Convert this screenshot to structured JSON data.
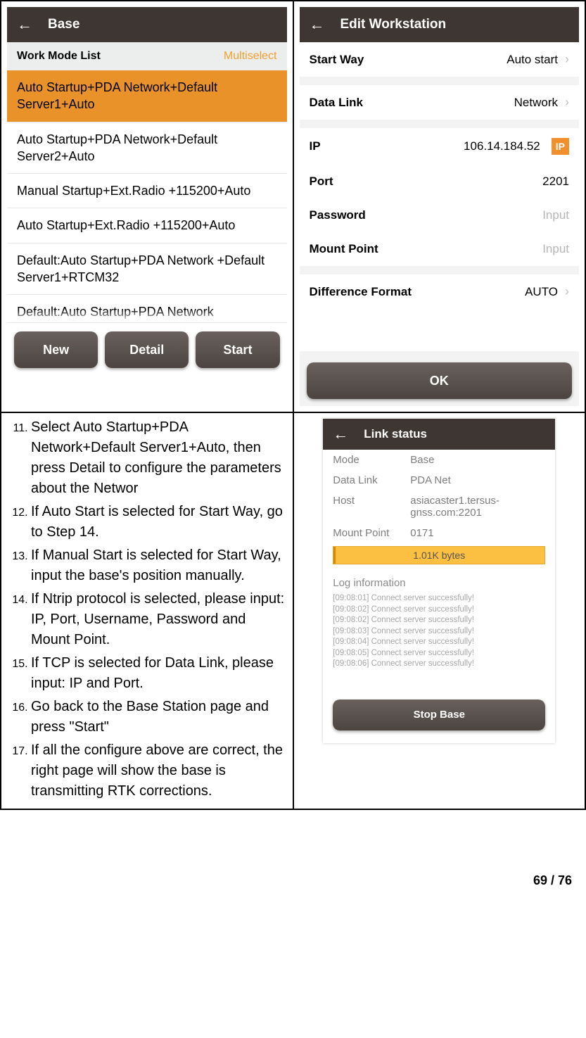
{
  "base_screen": {
    "header_title": "Base",
    "work_mode_list_label": "Work Mode List",
    "multiselect_label": "Multiselect",
    "items": [
      "Auto Startup+PDA Network+Default Server1+Auto",
      "Auto Startup+PDA Network+Default Server2+Auto",
      "Manual Startup+Ext.Radio +115200+Auto",
      "Auto Startup+Ext.Radio +115200+Auto",
      "Default:Auto Startup+PDA Network +Default Server1+RTCM32",
      "Default:Auto Startup+PDA Network"
    ],
    "buttons": {
      "new": "New",
      "detail": "Detail",
      "start": "Start"
    }
  },
  "edit_screen": {
    "header_title": "Edit Workstation",
    "fields": {
      "start_way": {
        "label": "Start Way",
        "value": "Auto start"
      },
      "data_link": {
        "label": "Data Link",
        "value": "Network"
      },
      "ip": {
        "label": "IP",
        "value": "106.14.184.52",
        "badge": "IP"
      },
      "port": {
        "label": "Port",
        "value": "2201"
      },
      "password": {
        "label": "Password",
        "placeholder": "Input"
      },
      "mount": {
        "label": "Mount Point",
        "placeholder": "Input"
      },
      "diff": {
        "label": "Difference Format",
        "value": "AUTO"
      }
    },
    "ok_label": "OK"
  },
  "instructions": {
    "start": 11,
    "items": [
      "Select Auto Startup+PDA Network+Default Server1+Auto, then press Detail to configure the parameters about the Networ",
      "If Auto Start is selected for Start Way, go to Step 14.",
      "If Manual Start is selected for Start Way, input the base's position manually.",
      "If Ntrip protocol is selected, please input: IP, Port, Username, Password and Mount Point.",
      "If TCP is selected for Data Link, please input: IP and Port.",
      "Go back to the Base Station page and press \"Start\"",
      "If all the configure above are correct, the right page will show the base is transmitting RTK corrections."
    ]
  },
  "link_status": {
    "header_title": "Link status",
    "kv": {
      "mode": {
        "label": "Mode",
        "value": "Base"
      },
      "dlink": {
        "label": "Data Link",
        "value": "PDA Net"
      },
      "host": {
        "label": "Host",
        "value": "asiacaster1.tersus-gnss.com:2201"
      },
      "mount": {
        "label": "Mount Point",
        "value": "0171"
      }
    },
    "progress_text": "1.01K bytes",
    "log_title": "Log information",
    "log_lines": [
      "[09:08:01] Connect server successfully!",
      "[09:08:02] Connect server successfully!",
      "[09:08:02] Connect server successfully!",
      "[09:08:03] Connect server successfully!",
      "[09:08:04] Connect server successfully!",
      "[09:08:05] Connect server successfully!",
      "[09:08:06] Connect server successfully!"
    ],
    "stop_label": "Stop Base"
  },
  "page_number": "69 / 76"
}
